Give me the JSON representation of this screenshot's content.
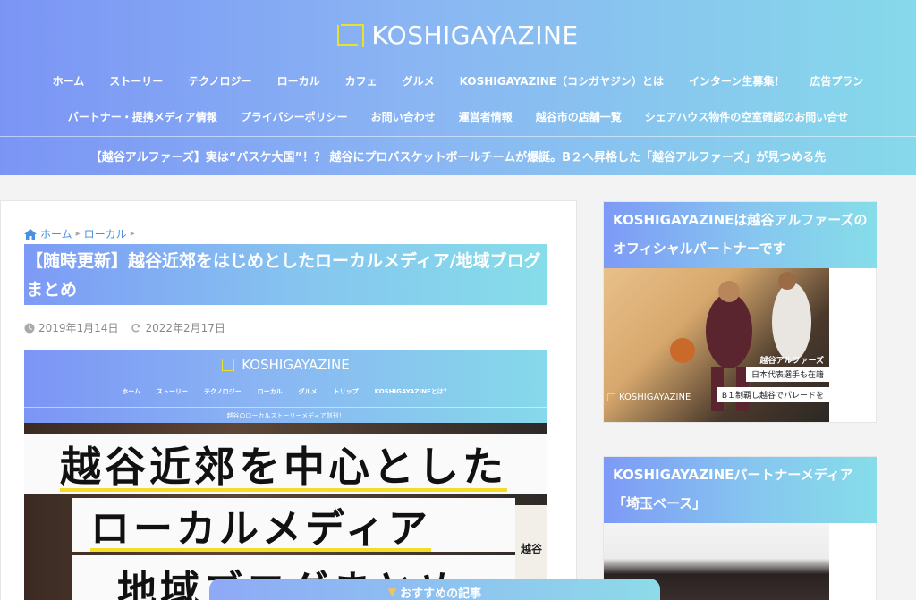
{
  "site": {
    "title": "KOSHIGAYAZINE"
  },
  "nav": {
    "row1": [
      "ホーム",
      "ストーリー",
      "テクノロジー",
      "ローカル",
      "カフェ",
      "グルメ",
      "KOSHIGAYAZINE（コシガヤジン）とは",
      "インターン生募集！",
      "広告プラン"
    ],
    "row2": [
      "パートナー・提携メディア情報",
      "プライバシーポリシー",
      "お問い合わせ",
      "運営者情報",
      "越谷市の店舗一覧",
      "シェアハウス物件の空室確認のお問い合せ"
    ]
  },
  "announcement": "【越谷アルファーズ】実は“バスケ大国”！？ 越谷にプロバスケットボールチームが爆誕。B２へ昇格した「越谷アルファーズ」が見つめる先",
  "breadcrumb": {
    "home": "ホーム",
    "category": "ローカル"
  },
  "article": {
    "title": "【随時更新】越谷近郊をはじめとしたローカルメディア/地域ブログまとめ",
    "published": "2019年1月14日",
    "updated": "2022年2月17日"
  },
  "featured_image": {
    "logo": "KOSHIGAYAZINE",
    "nav": [
      "ホーム",
      "ストーリー",
      "テクノロジー",
      "ローカル",
      "グルメ",
      "トリップ",
      "KOSHIGAYAZINEとは？"
    ],
    "subtitle": "越谷のローカルストーリーメディア創刊！",
    "line1": "越谷近郊を中心とした",
    "line2": "ローカルメディア",
    "line3": "地域ブログまとめ",
    "side_text": "越谷"
  },
  "sidebar": {
    "widget1": {
      "title": "KOSHIGAYAZINEは越谷アルファーズのオフィシャルパートナーです",
      "caption1": "越谷アルファーズ",
      "caption2": "日本代表選手も在籍",
      "caption3": "B１制覇し越谷でパレードを",
      "logo": "KOSHIGAYAZINE"
    },
    "widget2": {
      "title": "KOSHIGAYAZINEパートナーメディア「埼玉ベース」"
    }
  },
  "recommend_bar": "おすすめの記事",
  "colors": {
    "gradient_start": "#7b95f5",
    "gradient_end": "#86d9ea",
    "logo_yellow": "#e8e22a",
    "link_blue": "#4a90e2",
    "underline_yellow": "#f4dc2a"
  }
}
